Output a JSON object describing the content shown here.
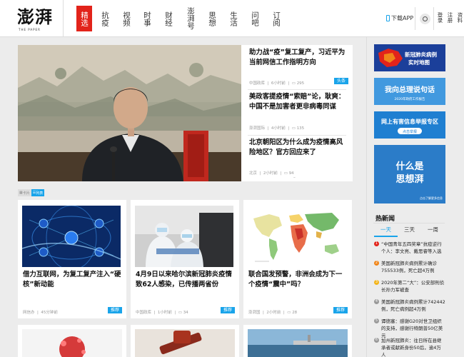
{
  "header": {
    "logo_cn": "澎湃",
    "logo_en": "THE PAPER",
    "nav": [
      "精选",
      "抗疫",
      "视频",
      "时事",
      "财经",
      "澎湃号",
      "思想",
      "生活",
      "问吧",
      "订阅"
    ],
    "download_label": "下载APP",
    "login_label": "登录",
    "register_label": "注册",
    "profile_label": "资料"
  },
  "hero": {
    "items": [
      {
        "title": "助力战“疫”复工复产，习近平为当前网信工作指明方向",
        "source": "中国政库",
        "time": "6小时前",
        "comments": "295",
        "tag": "头条"
      },
      {
        "title": "美政客提疫情“索赔”论，耿爽：中国不是加害者更非病毒同谋",
        "source": "澎湃国际",
        "time": "4小时前",
        "comments": "135"
      },
      {
        "title": "北京朝阳区为什么成为疫情高风险地区？官方回应来了",
        "source": "北京",
        "time": "2小时前",
        "comments": "94"
      }
    ]
  },
  "view_toggle": {
    "card": "卡片",
    "list": "列表"
  },
  "cards": [
    {
      "title": "借力互联网，为复工复产注入“硬核”新动能",
      "source": "网信办",
      "time": "45分钟前",
      "comments": "",
      "tag": "推荐"
    },
    {
      "title": "4月9日以来哈尔滨新冠肺炎疫情致62人感染，已传播两省份",
      "source": "中国政库",
      "time": "1小时前",
      "comments": "34",
      "tag": "推荐"
    },
    {
      "title": "联合国发预警，非洲会成为下一个疫情“震中”吗？",
      "source": "澎湃国",
      "time": "2小时前",
      "comments": "28",
      "tag": "推荐"
    }
  ],
  "sidebar": {
    "banner_map": {
      "line1": "新冠肺炎病例",
      "line2": "实时地图"
    },
    "banner_report": {
      "text": "我向总理说句话",
      "sub": "2020年政府工作报告"
    },
    "banner_tip": {
      "title": "网上有害信息举报专区",
      "button": "点击举报"
    },
    "banner_thought": {
      "line1": "什么是",
      "line2": "思想湃",
      "sub": "点击了解更多信息"
    }
  },
  "hot": {
    "title": "热新闻",
    "tabs": [
      "一天",
      "三天",
      "一周"
    ],
    "items": [
      "“中国青年五四奖章”抗疫逆行个人：李文亮、戴思睿等入选",
      "美国新冠肺炎病例累计确诊755533例，死亡超4万例",
      "2020年第二“大”：公安部刑侦长孙力军被查",
      "美国新冠肺炎病例累计742442例，死亡病例超4万例",
      "谭德塞：感谢G20对世卫组织的支持，感谢行特朗普50亿美元",
      "加州新冠肺炎：往日所在县继承者或献新身份50后，逾4万人"
    ]
  },
  "colors": {
    "accent_red": "#e2231a",
    "tag_blue": "#19a4ea"
  }
}
